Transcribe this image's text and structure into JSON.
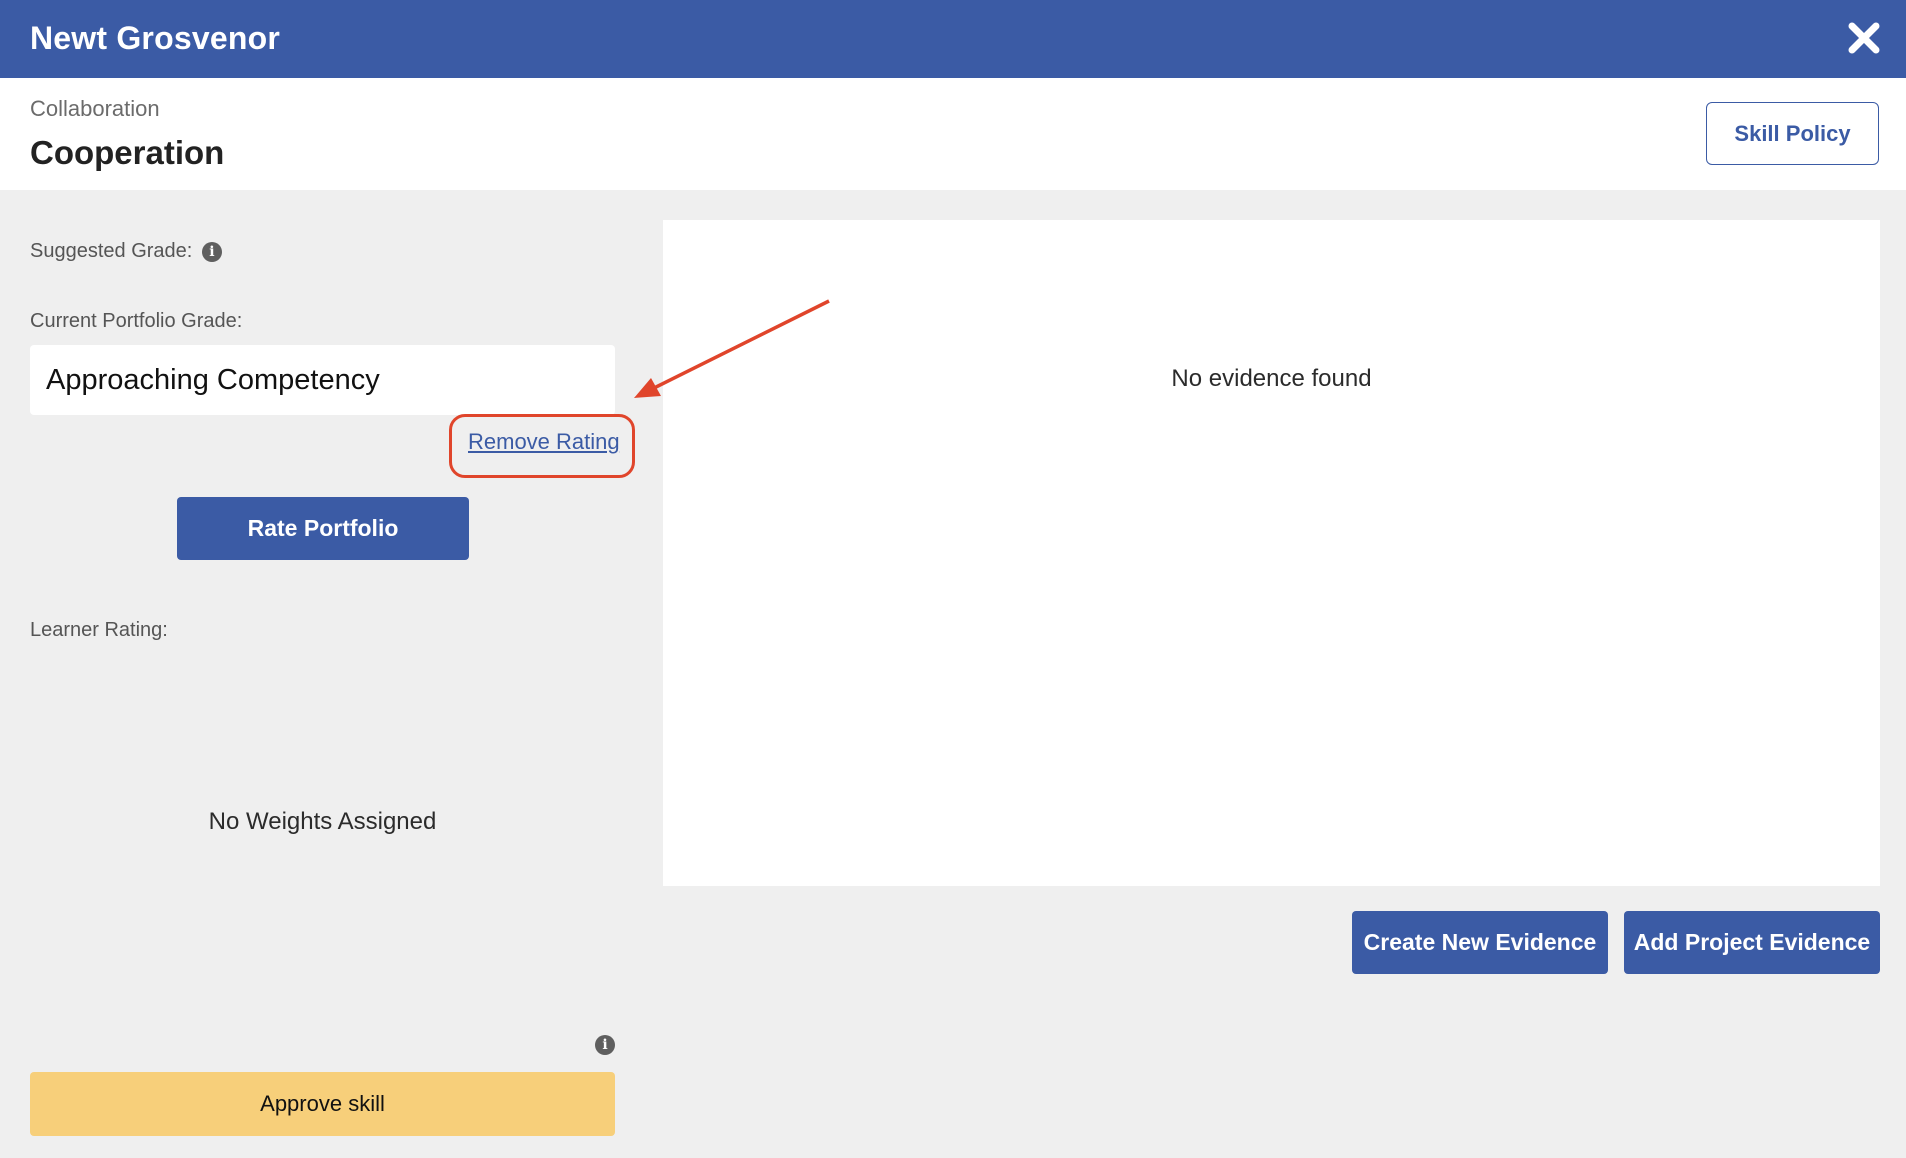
{
  "header": {
    "title": "Newt Grosvenor",
    "close_icon": "close-icon"
  },
  "skill": {
    "category": "Collaboration",
    "name": "Cooperation",
    "policy_label": "Skill Policy"
  },
  "left": {
    "suggested_grade_label": "Suggested Grade:",
    "current_grade_label": "Current Portfolio Grade:",
    "current_grade_value": "Approaching Competency",
    "remove_rating_label": "Remove Rating",
    "rate_portfolio_label": "Rate Portfolio",
    "learner_rating_label": "Learner Rating:",
    "no_weights_text": "No Weights Assigned",
    "approve_label": "Approve skill",
    "info_glyph": "i"
  },
  "evidence": {
    "empty_text": "No evidence found",
    "create_label": "Create New Evidence",
    "add_project_label": "Add Project Evidence"
  },
  "colors": {
    "primary": "#3b5ba5",
    "approve": "#f7cf7a",
    "annotation": "#e0452b",
    "background": "#efefef"
  }
}
